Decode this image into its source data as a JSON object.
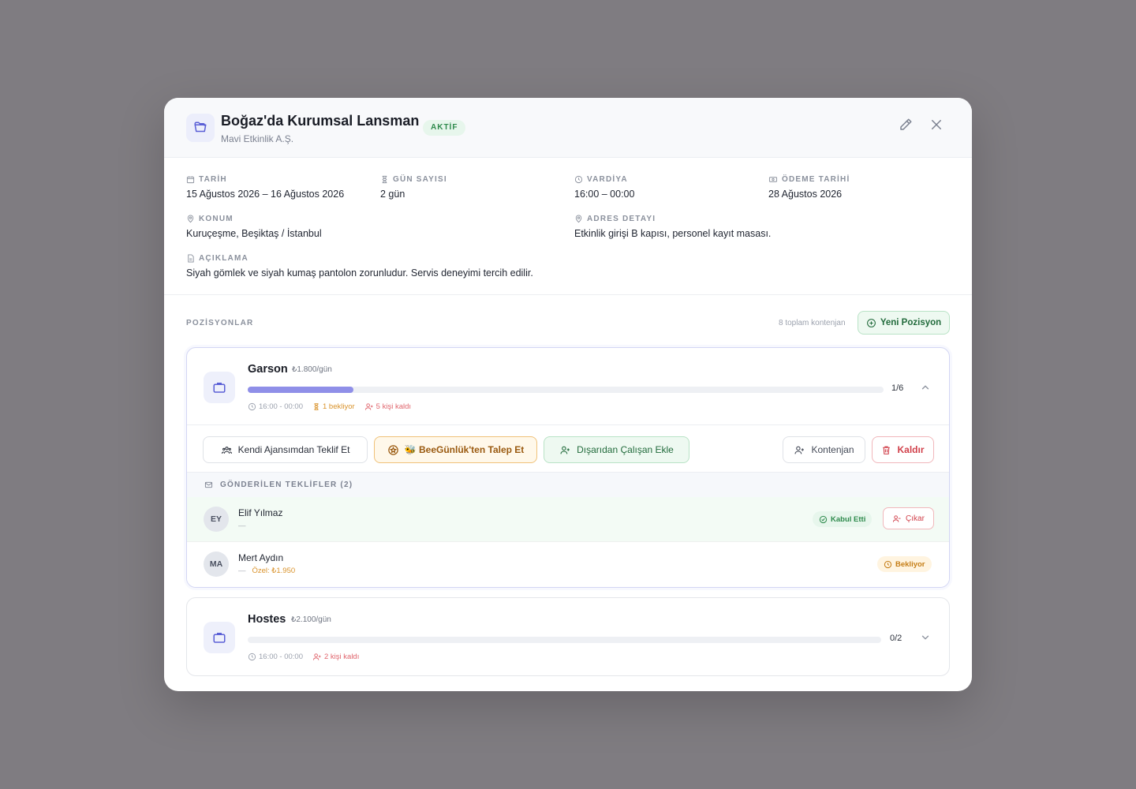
{
  "header": {
    "title": "Boğaz'da Kurumsal Lansman",
    "company": "Mavi Etkinlik A.Ş.",
    "status_badge": "AKTİF"
  },
  "info": {
    "date": {
      "label": "TARİH",
      "value": "15 Ağustos 2026 – 16 Ağustos 2026"
    },
    "days": {
      "label": "GÜN SAYISI",
      "value": "2 gün"
    },
    "shift": {
      "label": "VARDİYA",
      "value": "16:00 – 00:00"
    },
    "payment": {
      "label": "ÖDEME TARİHİ",
      "value": "28 Ağustos 2026"
    },
    "location": {
      "label": "KONUM",
      "value": "Kuruçeşme, Beşiktaş / İstanbul"
    },
    "address": {
      "label": "ADRES DETAYI",
      "value": "Etkinlik girişi B kapısı, personel kayıt masası."
    },
    "description": {
      "label": "AÇIKLAMA",
      "value": "Siyah gömlek ve siyah kumaş pantolon zorunludur. Servis deneyimi tercih edilir."
    }
  },
  "positions": {
    "label": "POZİSYONLAR",
    "total": "8 toplam kontenjan",
    "new_button": "Yeni Pozisyon",
    "items": [
      {
        "title": "Garson",
        "rate": "₺1.800/gün",
        "count": "1/6",
        "filled": 1,
        "capacity": 6,
        "time": "16:00 - 00:00",
        "waiting": "1 bekliyor",
        "remaining": "5 kişi kaldı",
        "actions": {
          "agency": "Kendi Ajansımdan Teklif Et",
          "bee": "🐝 BeeGünlük'ten Talep Et",
          "external": "Dışarıdan Çalışan Ekle",
          "quota": "Kontenjan",
          "remove": "Kaldır"
        },
        "offers_title": "GÖNDERİLEN TEKLİFLER (2)",
        "offers": [
          {
            "initials": "EY",
            "name": "Elif Yılmaz",
            "sub": "—",
            "special": "",
            "status": "Kabul Etti",
            "remove": "Çıkar"
          },
          {
            "initials": "MA",
            "name": "Mert Aydın",
            "sub": "—",
            "special": "Özel: ₺1.950",
            "status": "Bekliyor"
          }
        ]
      },
      {
        "title": "Hostes",
        "rate": "₺2.100/gün",
        "count": "0/2",
        "filled": 0,
        "capacity": 2,
        "time": "16:00 - 00:00",
        "remaining": "2 kişi kaldı"
      }
    ]
  },
  "colors": {
    "accent": "#8f8fe8",
    "success": "#2e8a4c",
    "warning": "#d9922a",
    "danger": "#d1414b"
  }
}
